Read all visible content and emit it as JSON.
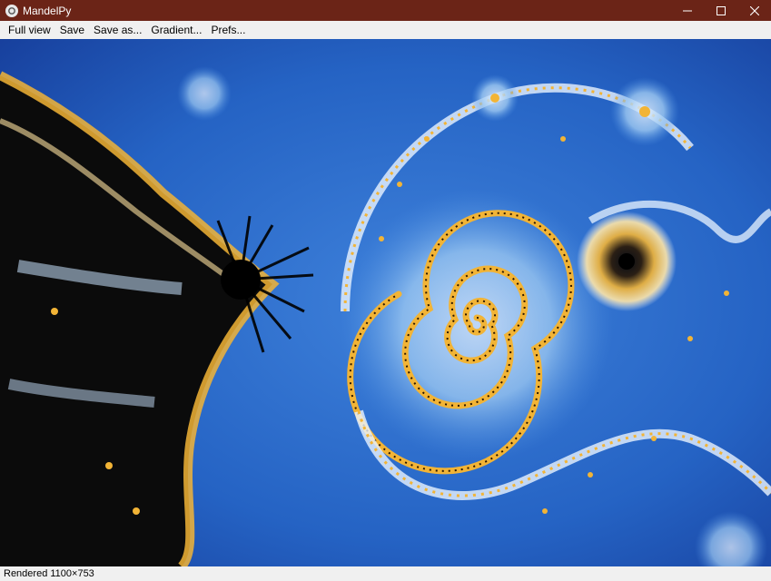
{
  "window": {
    "title": "MandelPy",
    "titlebar_color": "#6b2417"
  },
  "menu": {
    "items": [
      {
        "label": "Full view"
      },
      {
        "label": "Save"
      },
      {
        "label": "Save as..."
      },
      {
        "label": "Gradient..."
      },
      {
        "label": "Prefs..."
      }
    ]
  },
  "status": {
    "text": "Rendered 1100×753"
  },
  "image": {
    "subject": "mandelbrot-fractal-spiral",
    "colors": {
      "deep_blue": "#1a4fb8",
      "light_blue": "#8fc0ee",
      "pale": "#eaf4ff",
      "gold": "#f2b436",
      "black": "#000000"
    }
  }
}
